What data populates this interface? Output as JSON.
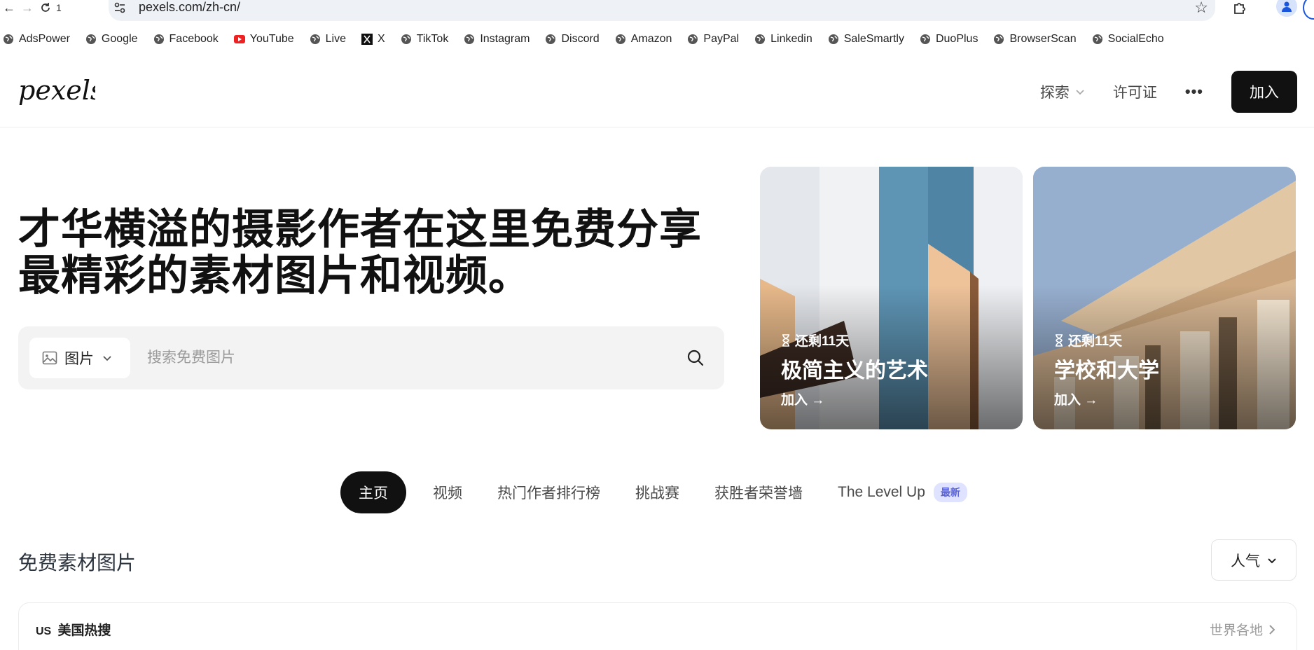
{
  "browser": {
    "tab_count": "1",
    "url": "pexels.com/zh-cn/"
  },
  "bookmarks": [
    {
      "label": "AdsPower",
      "icon": "globe-icon"
    },
    {
      "label": "Google",
      "icon": "globe-icon"
    },
    {
      "label": "Facebook",
      "icon": "globe-icon"
    },
    {
      "label": "YouTube",
      "icon": "youtube-icon"
    },
    {
      "label": "Live",
      "icon": "globe-icon"
    },
    {
      "label": "X",
      "icon": "x-logo-icon"
    },
    {
      "label": "TikTok",
      "icon": "globe-icon"
    },
    {
      "label": "Instagram",
      "icon": "globe-icon"
    },
    {
      "label": "Discord",
      "icon": "globe-icon"
    },
    {
      "label": "Amazon",
      "icon": "globe-icon"
    },
    {
      "label": "PayPal",
      "icon": "globe-icon"
    },
    {
      "label": "Linkedin",
      "icon": "globe-icon"
    },
    {
      "label": "SaleSmartly",
      "icon": "globe-icon"
    },
    {
      "label": "DuoPlus",
      "icon": "globe-icon"
    },
    {
      "label": "BrowserScan",
      "icon": "globe-icon"
    },
    {
      "label": "SocialEcho",
      "icon": "globe-icon"
    }
  ],
  "header": {
    "logo": "pexels",
    "explore": "探索",
    "license": "许可证",
    "more": "•••",
    "join": "加入"
  },
  "hero": {
    "title": "才华横溢的摄影作者在这里免费分享最精彩的素材图片和视频。",
    "search_type": "图片",
    "search_placeholder": "搜索免费图片"
  },
  "cards": [
    {
      "time_left": "还剩11天",
      "title": "极简主义的艺术",
      "join": "加入 →"
    },
    {
      "time_left": "还剩11天",
      "title": "学校和大学",
      "join": "加入 →"
    }
  ],
  "tabs": [
    {
      "label": "主页",
      "active": true
    },
    {
      "label": "视频"
    },
    {
      "label": "热门作者排行榜"
    },
    {
      "label": "挑战赛"
    },
    {
      "label": "获胜者荣誉墙"
    },
    {
      "label": "The Level Up",
      "badge": "最新"
    }
  ],
  "section": {
    "title": "免费素材图片",
    "sort": "人气"
  },
  "trending": {
    "country_code": "US",
    "label": "美国热搜",
    "worldwide": "世界各地"
  },
  "colors": {
    "accent": "#111111",
    "badge_bg": "#dfe3ff",
    "badge_text": "#5a63d8",
    "address_bar": "#eef1f6"
  }
}
